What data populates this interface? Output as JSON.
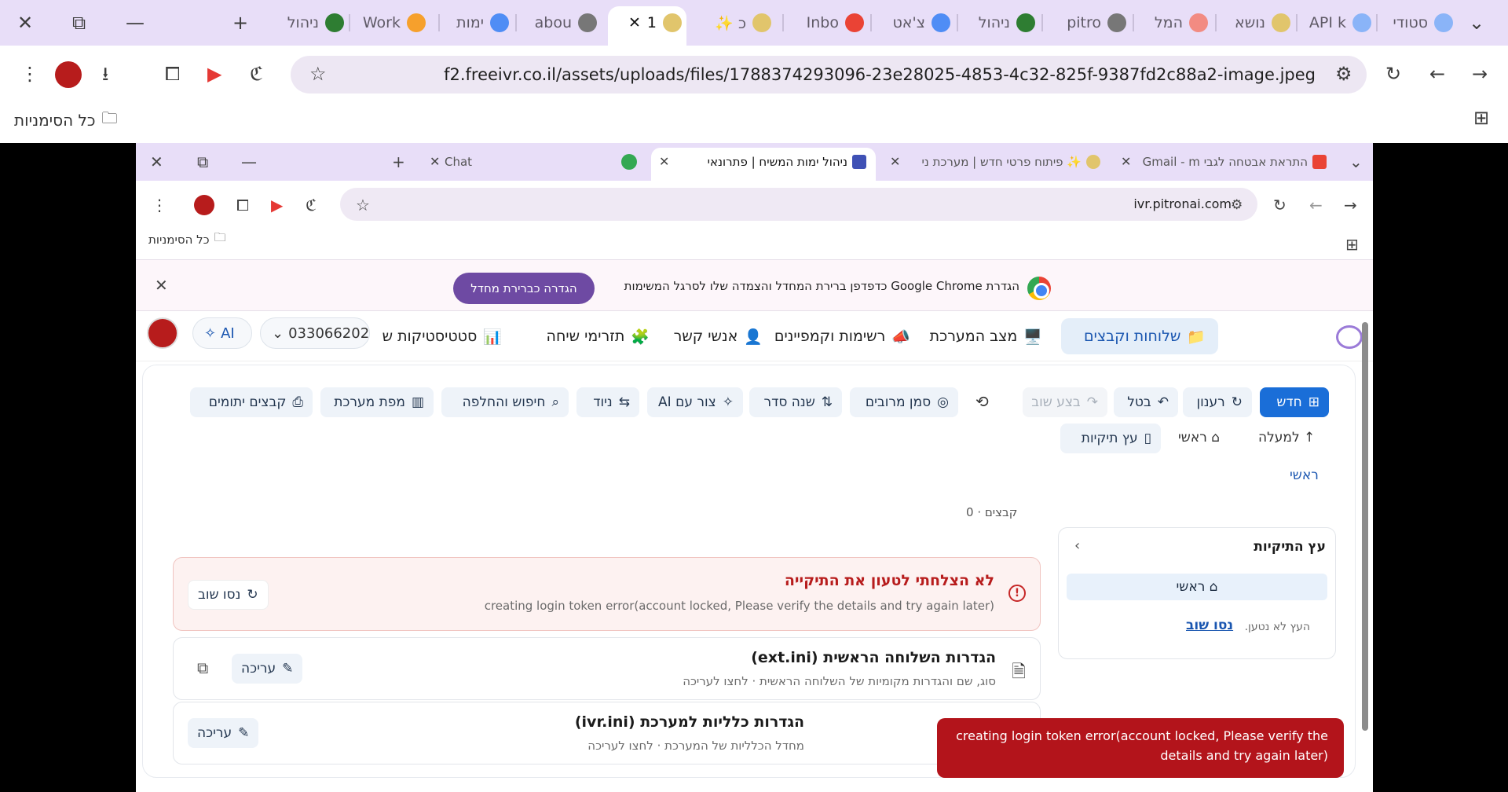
{
  "outer_browser": {
    "tabs": [
      {
        "label": "סטודי",
        "icon": "edit-icon"
      },
      {
        "label": "API k",
        "icon": "edit-icon"
      },
      {
        "label": "נושא",
        "icon": "globe-icon"
      },
      {
        "label": "המל",
        "icon": "gift-icon"
      },
      {
        "label": "pitro",
        "icon": "globe-icon"
      },
      {
        "label": "ניהול",
        "icon": "leaf-icon"
      },
      {
        "label": "צ'אט",
        "icon": "rainbow-icon"
      },
      {
        "label": "Inbo",
        "icon": "gmail-icon"
      },
      {
        "label": "כ ✨",
        "icon": "globe-icon"
      },
      {
        "label": "1",
        "icon": "globe-icon"
      },
      {
        "label": "abou",
        "icon": "globe-icon"
      },
      {
        "label": "ימות",
        "icon": "rainbow-icon"
      },
      {
        "label": "Work",
        "icon": "cloud-icon"
      },
      {
        "label": "ניהול",
        "icon": "leaf-icon"
      }
    ],
    "url": "f2.freeivr.co.il/assets/uploads/files/1788374293096-23e28025-4853-4c32-825f-9387fd2c88a2-image.jpeg",
    "bookmarks_label": "כל הסימניות"
  },
  "inner_browser": {
    "tabs": [
      {
        "label": "התראת אבטחה לגבי Gmail - m",
        "icon": "gmail-icon"
      },
      {
        "label": "✨ פיתוח פרטי חדש | מערכת ני",
        "icon": "globe-icon"
      },
      {
        "label": "ניהול ימות המשיח | פתרונאי",
        "icon": "app-icon"
      },
      {
        "label": "Chat",
        "icon": "chat-icon"
      }
    ],
    "url": "ivr.pitronai.com",
    "bookmarks_label": "כל הסימניות"
  },
  "notice": {
    "text": "הגדרת Google Chrome כדפדפן ברירת המחדל והצמדה שלו לסרגל המשימות",
    "button": "הגדרה כברירת מחדל"
  },
  "app_nav": {
    "items": [
      {
        "label": "שלוחות וקבצים",
        "icon": "📁",
        "active": true
      },
      {
        "label": "מצב המערכת",
        "icon": "🖥️",
        "active": false
      },
      {
        "label": "רשימות וקמפיינים",
        "icon": "📣",
        "active": false
      },
      {
        "label": "אנשי קשר",
        "icon": "👤",
        "active": false
      },
      {
        "label": "תזרימי שיחה",
        "icon": "🧩",
        "active": false
      },
      {
        "label": "סטטיסטיקות ש",
        "icon": "📊",
        "active": false
      }
    ],
    "phone": "033066202",
    "ai_label": "AI"
  },
  "toolbar": {
    "buttons": [
      "חדש",
      "רענון",
      "בטל",
      "בצע שוב",
      "סמן מרובים",
      "שנה סדר",
      "צור עם AI",
      "ניוד",
      "חיפוש והחלפה",
      "מפת מערכת",
      "קבצים יתומים"
    ],
    "nav": [
      "למעלה",
      "ראשי",
      "עץ תיקיות"
    ]
  },
  "breadcrumb": "ראשי",
  "tree_panel": {
    "title": "עץ התיקיות",
    "root_label": "⌂ ראשי",
    "error_text": "העץ לא נטען.",
    "retry": "נסו שוב"
  },
  "file_count": "קבצים · 0",
  "error_card": {
    "title": "לא הצלחתי לטעון את התיקייה",
    "message": "creating login token error(account locked, Please verify the details and try again later)",
    "retry": "נסו שוב"
  },
  "cards": [
    {
      "title": "הגדרות השלוחה הראשית (ext.ini)",
      "subtitle": "סוג, שם והגדרות מקומיות של השלוחה הראשית · לחצו לעריכה",
      "edit": "עריכה"
    },
    {
      "title": "הגדרות כלליות למערכת (ivr.ini)",
      "subtitle": "מחדל הכלליות של המערכת · לחצו לעריכה",
      "edit": "עריכה"
    }
  ],
  "toast": {
    "message": "creating login token error(account locked, Please verify the details and try again later)"
  },
  "colors": {
    "accent": "#1a6ed8",
    "toast": "#b3141b",
    "notice_button": "#6e4aa3"
  }
}
